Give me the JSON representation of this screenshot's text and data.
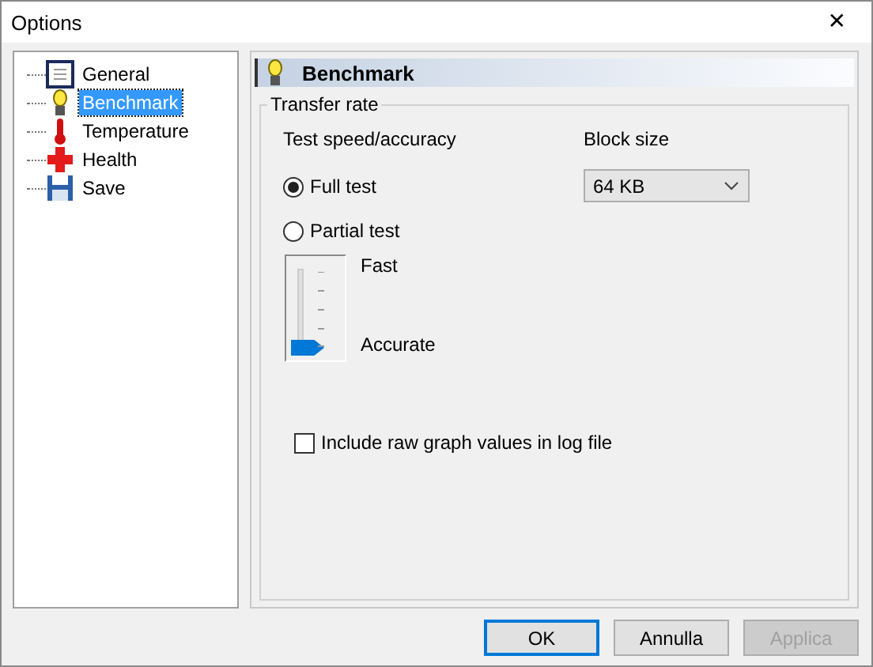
{
  "window": {
    "title": "Options",
    "close": "✕"
  },
  "tree": [
    {
      "label": "General",
      "kind": "page",
      "selected": false
    },
    {
      "label": "Benchmark",
      "kind": "bulb",
      "selected": true
    },
    {
      "label": "Temperature",
      "kind": "thermo",
      "selected": false
    },
    {
      "label": "Health",
      "kind": "cross",
      "selected": false
    },
    {
      "label": "Save",
      "kind": "disk",
      "selected": false
    }
  ],
  "header": {
    "title": "Benchmark"
  },
  "group": {
    "title": "Transfer rate",
    "speed_label": "Test speed/accuracy",
    "options": [
      {
        "label": "Full test",
        "selected": true
      },
      {
        "label": "Partial test",
        "selected": false
      }
    ],
    "slider": {
      "level": 0,
      "top_label": "Fast",
      "bottom_label": "Accurate"
    },
    "block_size": {
      "label": "Block size",
      "value": "64 KB"
    },
    "raw_values": {
      "label": "Include raw graph values in log file",
      "checked": false
    }
  },
  "buttons": [
    {
      "label": "OK",
      "default": true,
      "disabled": false
    },
    {
      "label": "Annulla",
      "default": false,
      "disabled": false
    },
    {
      "label": "Applica",
      "default": false,
      "disabled": true
    }
  ]
}
